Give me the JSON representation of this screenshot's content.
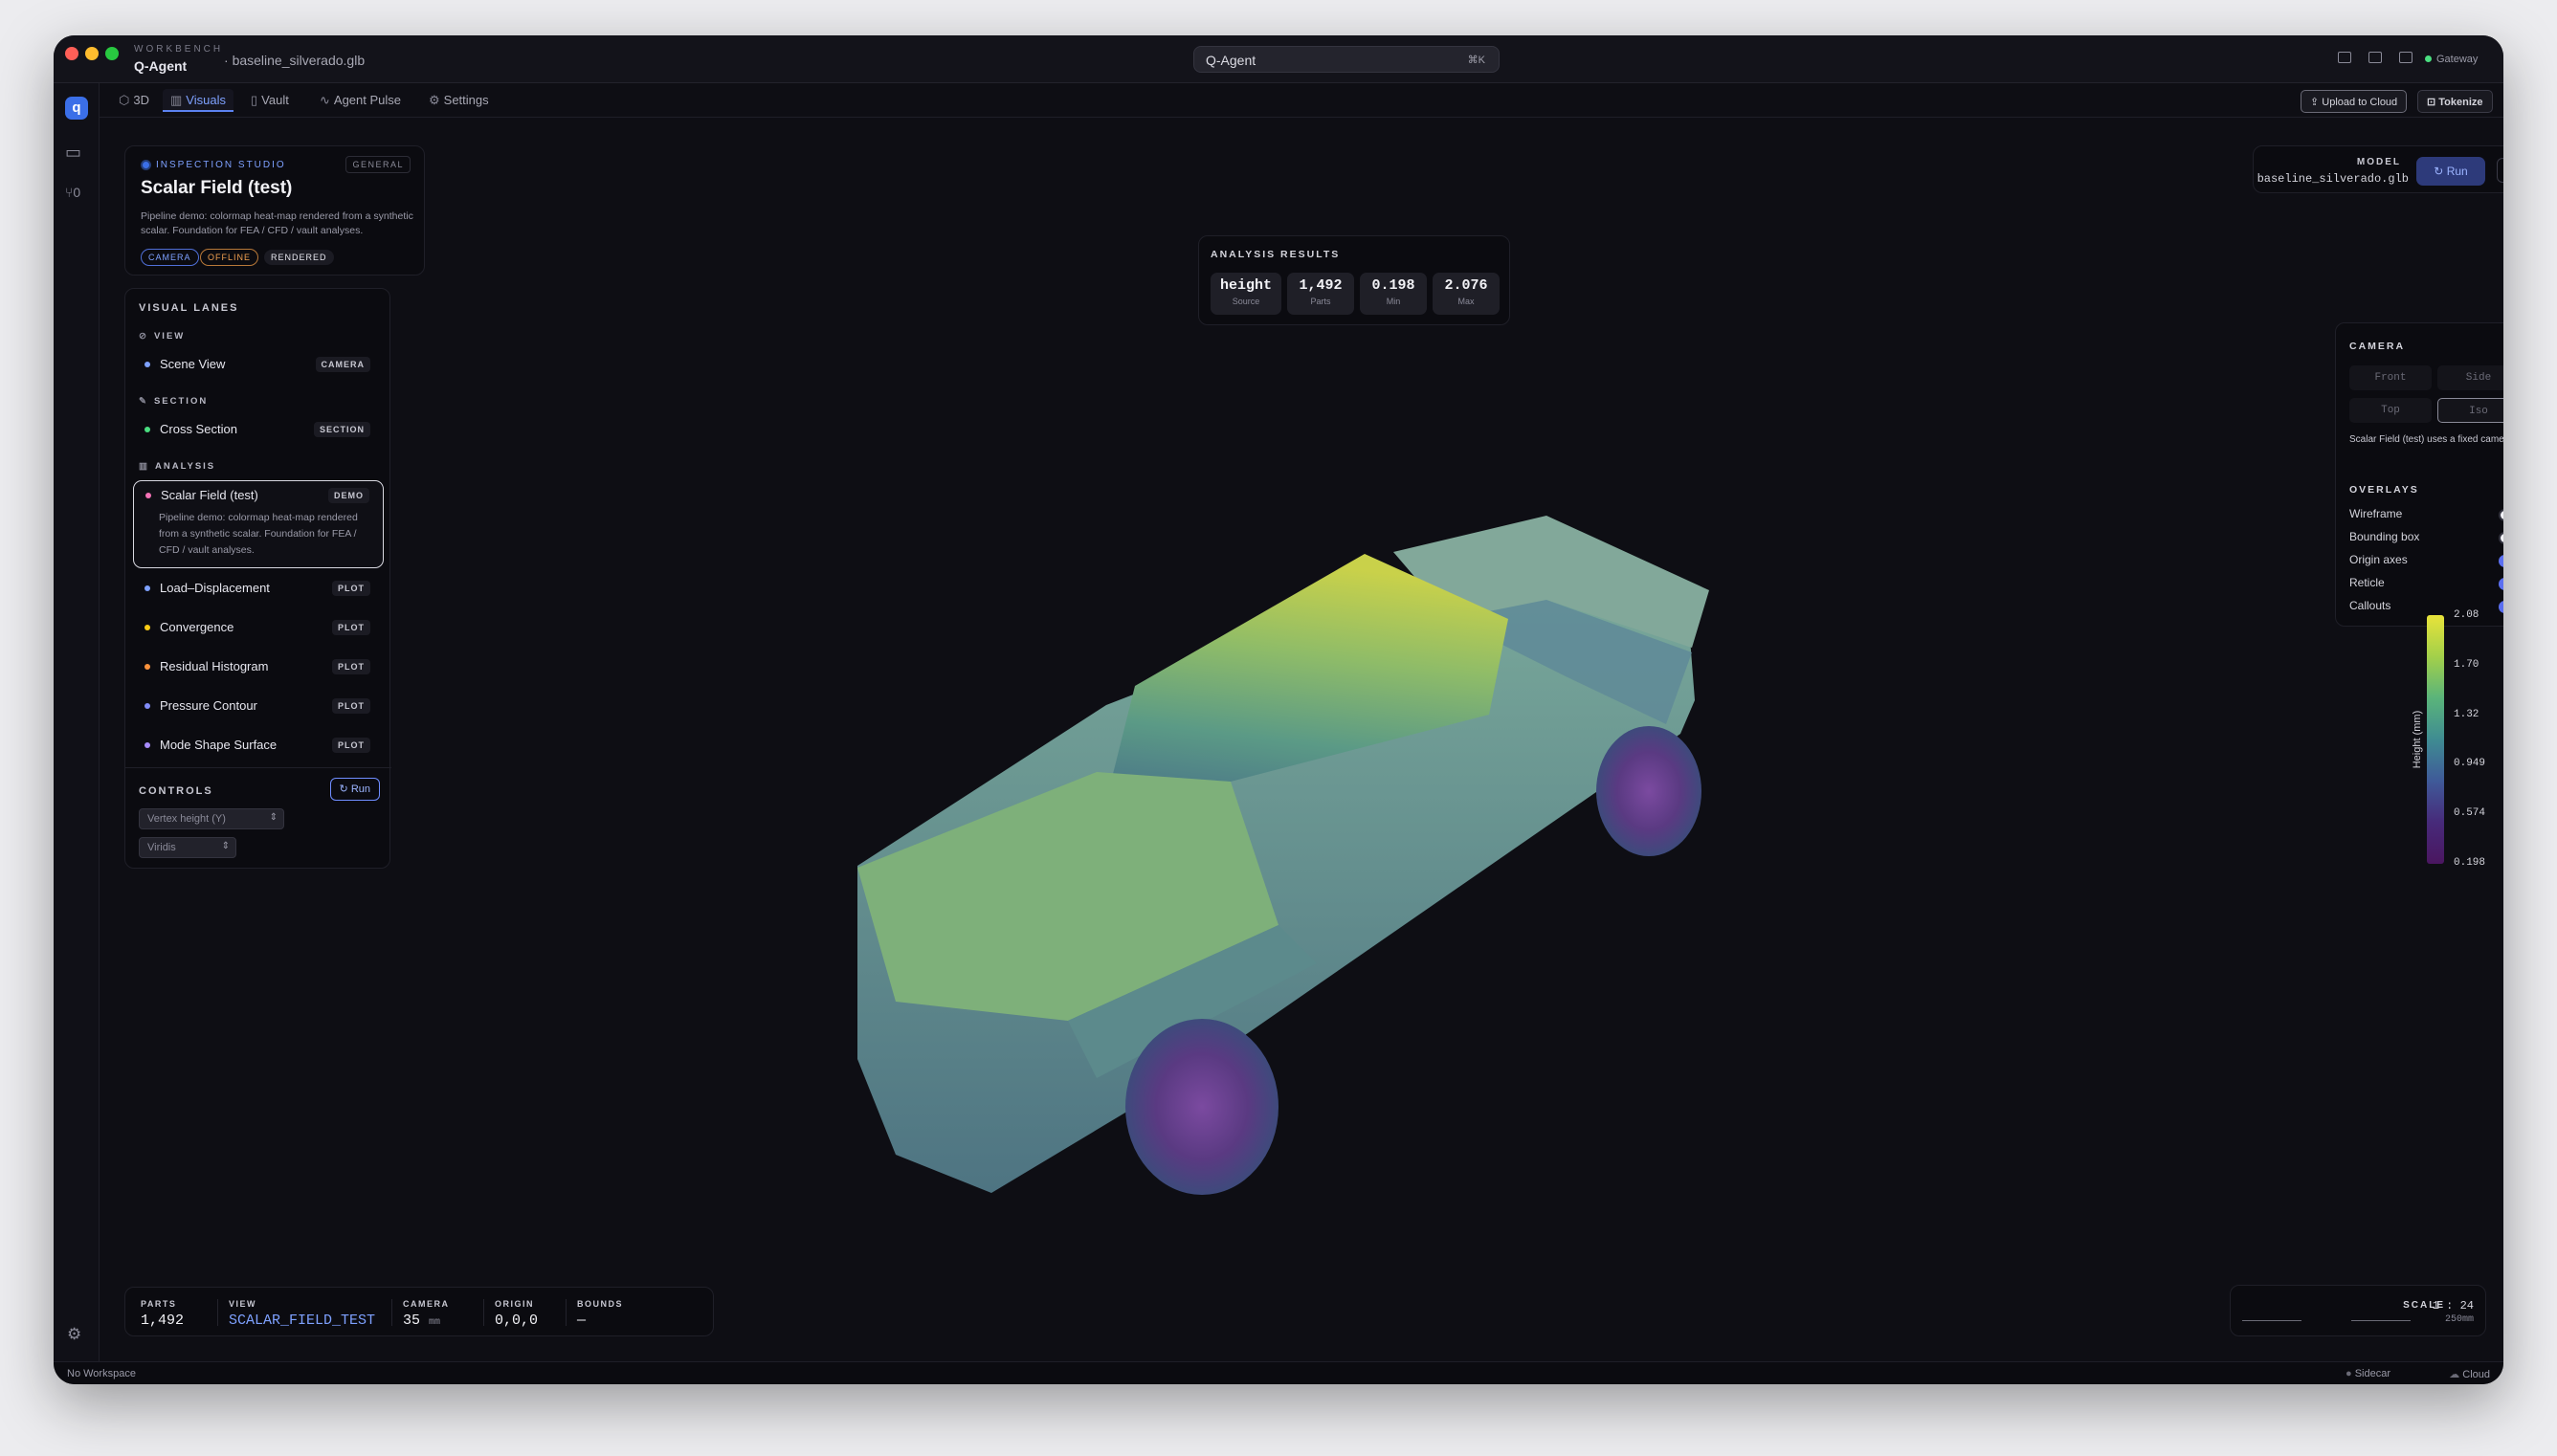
{
  "app": {
    "brand_small": "WORKBENCH",
    "brand_name": "Q-Agent",
    "file": "baseline_silverado.glb",
    "search": "Q-Agent",
    "search_kbd": "⌘K",
    "gateway": "Gateway"
  },
  "tabs": [
    {
      "label": "3D",
      "icon": "cube-icon"
    },
    {
      "label": "Visuals",
      "icon": "chart-icon"
    },
    {
      "label": "Vault",
      "icon": "book-icon"
    },
    {
      "label": "Agent Pulse",
      "icon": "pulse-icon"
    },
    {
      "label": "Settings",
      "icon": "gear-icon"
    }
  ],
  "actions": {
    "upload": "Upload to Cloud",
    "tokenize": "Tokenize"
  },
  "studio": {
    "label": "INSPECTION STUDIO",
    "scope": "GENERAL",
    "title": "Scalar Field (test)",
    "desc": "Pipeline demo: colormap heat-map rendered from a synthetic scalar. Foundation for FEA / CFD / vault analyses.",
    "chips": [
      "CAMERA",
      "OFFLINE",
      "RENDERED"
    ]
  },
  "lanes": {
    "title": "VISUAL LANES",
    "view": {
      "label": "VIEW",
      "item": "Scene View",
      "badge": "CAMERA"
    },
    "section": {
      "label": "SECTION",
      "item": "Cross Section",
      "badge": "SECTION"
    },
    "analysis": {
      "label": "ANALYSIS",
      "selected": {
        "item": "Scalar Field (test)",
        "badge": "DEMO",
        "desc": "Pipeline demo: colormap heat-map rendered from a synthetic scalar. Foundation for FEA / CFD / vault analyses."
      },
      "items": [
        {
          "item": "Load–Displacement",
          "badge": "PLOT"
        },
        {
          "item": "Convergence",
          "badge": "PLOT"
        },
        {
          "item": "Residual Histogram",
          "badge": "PLOT"
        },
        {
          "item": "Pressure Contour",
          "badge": "PLOT"
        },
        {
          "item": "Mode Shape Surface",
          "badge": "PLOT"
        }
      ]
    }
  },
  "controls": {
    "title": "CONTROLS",
    "run": "Run",
    "source": "Vertex height (Y)",
    "colormap": "Viridis"
  },
  "results": {
    "title": "ANALYSIS RESULTS",
    "stats": [
      {
        "v": "height",
        "k": "Source"
      },
      {
        "v": "1,492",
        "k": "Parts"
      },
      {
        "v": "0.198",
        "k": "Min"
      },
      {
        "v": "2.076",
        "k": "Max"
      }
    ]
  },
  "model": {
    "label": "MODEL",
    "file": "baseline_silverado.glb",
    "run": "Run"
  },
  "camera": {
    "title": "CAMERA",
    "views": [
      "Front",
      "Side",
      "Top",
      "Iso"
    ],
    "note": "Scalar Field (test) uses a fixed camera.",
    "overlays_title": "OVERLAYS",
    "overlays": [
      {
        "label": "Wireframe",
        "on": false
      },
      {
        "label": "Bounding box",
        "on": false
      },
      {
        "label": "Origin axes",
        "on": true
      },
      {
        "label": "Reticle",
        "on": true
      },
      {
        "label": "Callouts",
        "on": true
      }
    ]
  },
  "legend": {
    "title": "Height (mm)",
    "ticks": [
      "2.08",
      "1.70",
      "1.32",
      "0.949",
      "0.574",
      "0.198"
    ],
    "colors": [
      "#e8e33a",
      "#4a1660"
    ]
  },
  "status": {
    "parts_k": "PARTS",
    "parts_v": "1,492",
    "view_k": "VIEW",
    "view_v": "SCALAR_FIELD_TEST",
    "camera_k": "CAMERA",
    "camera_v": "35",
    "camera_u": "mm",
    "origin_k": "ORIGIN",
    "origin_v": "0,0,0",
    "bounds_k": "BOUNDS",
    "bounds_v": "—"
  },
  "scale": {
    "label": "SCALE",
    "ratio": "1 : 24",
    "mark": "250mm"
  },
  "footer": {
    "workspace": "No Workspace",
    "sidecar": "Sidecar",
    "cloud": "Cloud"
  }
}
